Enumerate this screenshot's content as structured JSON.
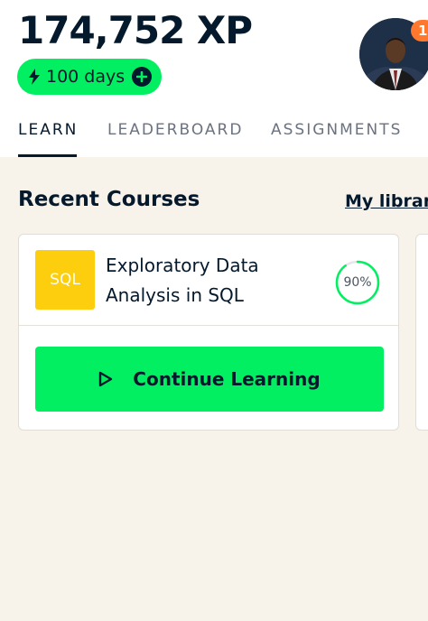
{
  "header": {
    "xp_value": "174,752 XP",
    "streak_label": "100 days",
    "notification_count": "1"
  },
  "tabs": [
    {
      "label": "LEARN",
      "active": true
    },
    {
      "label": "LEADERBOARD",
      "active": false
    },
    {
      "label": "ASSIGNMENTS",
      "active": false
    }
  ],
  "recent": {
    "title": "Recent Courses",
    "library_link": "My library",
    "course": {
      "badge": "SQL",
      "title": "Exploratory Data Analysis in SQL",
      "progress_percent": 90,
      "progress_label": "90%"
    },
    "continue_label": "Continue Learning"
  },
  "colors": {
    "accent_green": "#03ef62",
    "navy": "#05192d",
    "sql_yellow": "#fcce0d",
    "notification_orange": "#ff782d",
    "background_beige": "#f7f3eb"
  }
}
